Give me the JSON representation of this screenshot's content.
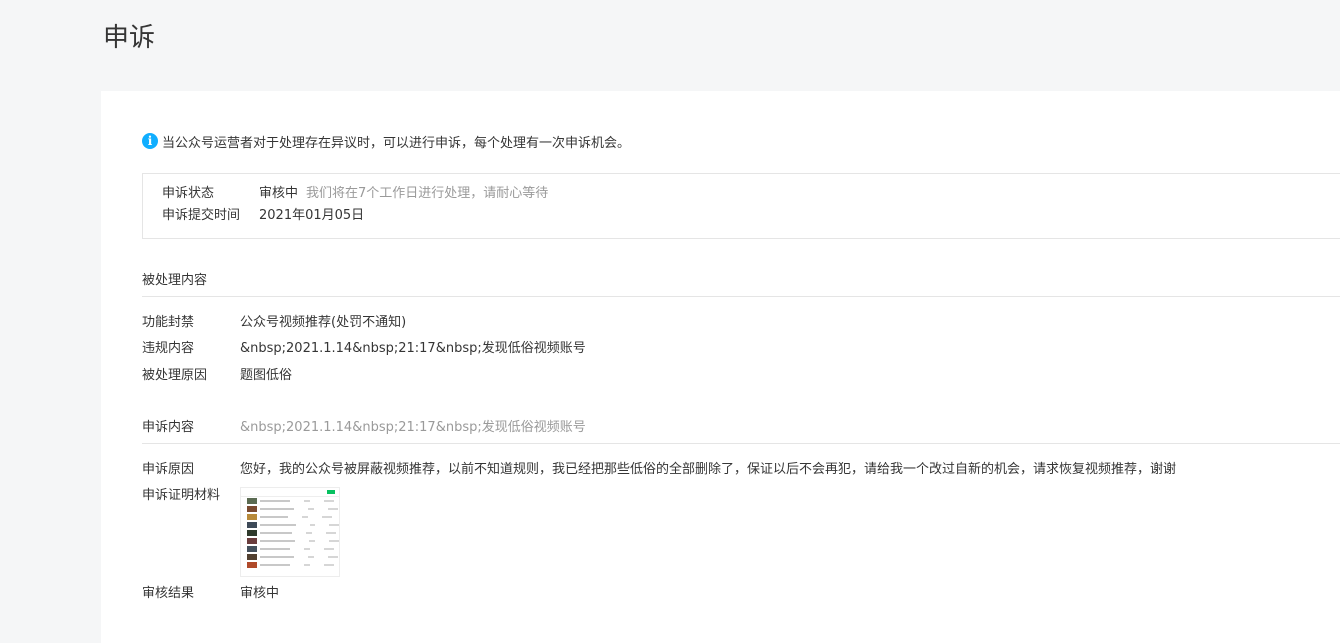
{
  "page": {
    "title": "申诉"
  },
  "notice": {
    "icon": "info-icon",
    "text": "当公众号运营者对于处理存在异议时，可以进行申诉，每个处理有一次申诉机会。"
  },
  "status": {
    "status_label": "申诉状态",
    "status_value": "审核中",
    "status_hint": "我们将在7个工作日进行处理，请耐心等待",
    "submit_label": "申诉提交时间",
    "submit_value": "2021年01月05日"
  },
  "handled": {
    "section_title": "被处理内容",
    "rows": [
      {
        "label": "功能封禁",
        "value": "公众号视频推荐(处罚不通知)"
      },
      {
        "label": "违规内容",
        "value": "&nbsp;2021.1.14&nbsp;21:17&nbsp;发现低俗视频账号"
      },
      {
        "label": "被处理原因",
        "value": "题图低俗"
      }
    ]
  },
  "appeal": {
    "content_label": "申诉内容",
    "content_value": "&nbsp;2021.1.14&nbsp;21:17&nbsp;发现低俗视频账号",
    "reason_label": "申诉原因",
    "reason_value": "您好，我的公众号被屏蔽视频推荐，以前不知道规则，我已经把那些低俗的全部删除了，保证以后不会再犯，请给我一个改过自新的机会，请求恢复视频推荐，谢谢",
    "evidence_label": "申诉证明材料",
    "result_label": "审核结果",
    "result_value": "审核中"
  },
  "colors": {
    "accent": "#10aeff",
    "muted_text": "#9a9a9a",
    "border": "#e5e5e5"
  }
}
